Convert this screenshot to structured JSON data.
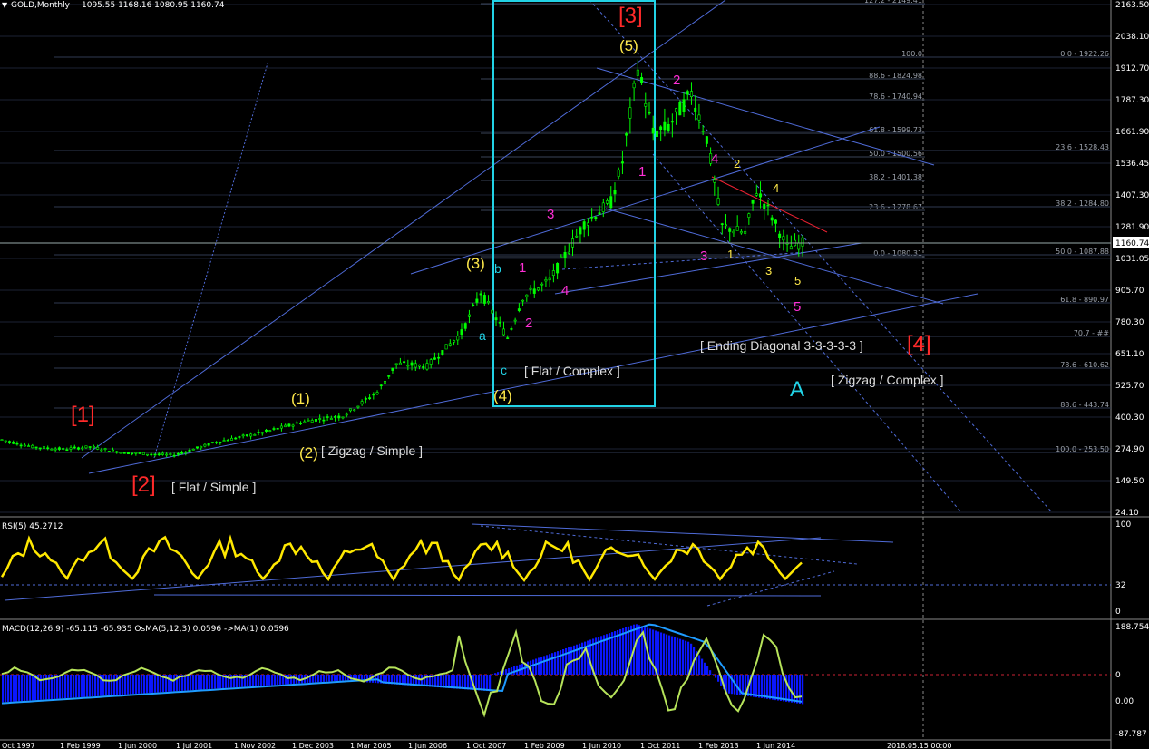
{
  "window": {
    "symbol_title": "GOLD,Monthly",
    "ohlc": "1095.55 1168.16 1080.95 1160.74"
  },
  "colors": {
    "background": "#000000",
    "grid": "#2f3a52",
    "trend": "#4f6bd8",
    "candle_up": "#00ff00",
    "candle_dn": "#00ff00",
    "box": "#22d3e6",
    "wave_red": "#ff2a2a",
    "wave_yellow": "#ffe94a",
    "wave_magenta": "#ff2fd6",
    "wave_cyan": "#22d3e6",
    "rsi_line": "#ffe800",
    "macd_hist": "#0b17ff",
    "macd_signal": "#1e9bff",
    "osma": "#b6e35a",
    "fib_text": "#9aa0aa"
  },
  "panels": {
    "rsi": {
      "label": "RSI(5) 45.2712",
      "scale": [
        "100",
        "32",
        "0"
      ]
    },
    "macd": {
      "label": "MACD(12,26,9) -65.115 -65.935  OsMA(5,12,3) 0.0596  ->MA(1) 0.0596",
      "scale": [
        "188.754",
        "0",
        "0.00",
        "-87.787"
      ]
    }
  },
  "current_price_label": "1160.74",
  "time_axis": [
    "Oct 1997",
    "1 Feb 1999",
    "1 Jun 2000",
    "1 Jul 2001",
    "1 Nov 2002",
    "1 Dec 2003",
    "1 Mar 2005",
    "1 Jun 2006",
    "1 Oct 2007",
    "1 Feb 2009",
    "1 Jun 2010",
    "1 Oct 2011",
    "1 Feb 2013",
    "1 Jun 2014",
    "2018.05.15 00:00"
  ],
  "price_axis": [
    "2163.50",
    "2038.10",
    "1912.70",
    "1787.30",
    "1661.90",
    "1536.45",
    "1407.30",
    "1281.90",
    "1031.05",
    "905.70",
    "780.30",
    "651.10",
    "525.70",
    "400.30",
    "274.90",
    "149.50",
    "24.10"
  ],
  "fib_levels": {
    "left": [
      "127.2 - 2149.41",
      "100.0",
      "88.6 - 1824.98",
      "78.6 - 1740.94",
      "61.8 - 1599.73",
      "50.0 - 1500.56",
      "38.2 - 1401.38",
      "23.6 - 1278.67",
      "0.0 - 1080.31"
    ],
    "right": [
      "0.0 - 1922.26",
      "23.6 - 1528.43",
      "38.2 - 1284.80",
      "50.0 - 1087.88",
      "61.8 - 890.97",
      "70.7 - ##",
      "78.6 - 610.62",
      "88.6 - 443.74",
      "100.0 - 253.50"
    ]
  },
  "annotations": {
    "red": [
      "[1]",
      "[2]",
      "[3]",
      "[4]"
    ],
    "yellow_major": [
      "(1)",
      "(2)",
      "(3)",
      "(4)",
      "(5)"
    ],
    "cyan_abc": [
      "a",
      "b",
      "c",
      "A"
    ],
    "magenta": [
      "1",
      "2",
      "3",
      "4",
      "1",
      "2",
      "3",
      "4",
      "5"
    ],
    "yellow_minor": [
      "2",
      "4",
      "1",
      "3",
      "5"
    ],
    "labels": [
      "[ Flat / Simple ]",
      "[ Zigzag / Simple ]",
      "[ Flat / Complex ]",
      "[ Ending Diagonal 3-3-3-3-3 ]",
      "[ Zigzag / Complex ]"
    ]
  },
  "chart_data": {
    "type": "line",
    "title": "GOLD,Monthly",
    "series": [
      {
        "name": "GOLD,Monthly",
        "x": [
          "1997-10",
          "1998-06",
          "1999-02",
          "1999-09",
          "2000-06",
          "2001-07",
          "2002-06",
          "2003-06",
          "2004-06",
          "2005-03",
          "2005-12",
          "2006-05",
          "2007-01",
          "2007-10",
          "2008-03",
          "2008-10",
          "2009-02",
          "2009-09",
          "2010-06",
          "2011-01",
          "2011-04",
          "2011-08",
          "2011-12",
          "2012-04",
          "2012-10",
          "2013-02",
          "2013-06",
          "2013-12",
          "2014-03",
          "2014-06",
          "2014-11",
          "2015-03"
        ],
        "values": [
          330,
          300,
          290,
          300,
          275,
          265,
          320,
          360,
          410,
          430,
          530,
          650,
          640,
          780,
          950,
          760,
          930,
          1000,
          1240,
          1330,
          1500,
          1900,
          1620,
          1650,
          1790,
          1600,
          1230,
          1200,
          1380,
          1300,
          1140,
          1160
        ]
      }
    ],
    "ylim": [
      24.1,
      2163.5
    ],
    "rsi": {
      "name": "RSI(5)",
      "last": 45.2712,
      "ylim": [
        0,
        100
      ],
      "level": 32
    },
    "macd": {
      "name": "MACD(12,26,9)",
      "ylim": [
        -87.787,
        188.754
      ],
      "last": -65.115
    }
  }
}
